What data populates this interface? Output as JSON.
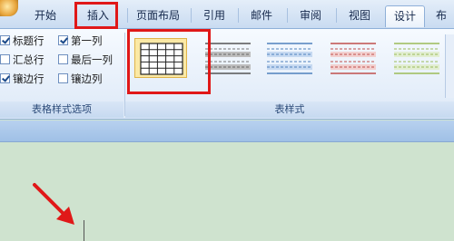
{
  "tabs": [
    {
      "label": "开始"
    },
    {
      "label": "插入"
    },
    {
      "label": "页面布局"
    },
    {
      "label": "引用"
    },
    {
      "label": "邮件"
    },
    {
      "label": "审阅"
    },
    {
      "label": "视图"
    },
    {
      "label": "设计"
    },
    {
      "label": "布"
    }
  ],
  "active_tab": "设计",
  "style_options": {
    "group_label": "表格样式选项",
    "items": [
      {
        "label": "标题行",
        "checked": true
      },
      {
        "label": "第一列",
        "checked": true
      },
      {
        "label": "汇总行",
        "checked": false
      },
      {
        "label": "最后一列",
        "checked": false
      },
      {
        "label": "镶边行",
        "checked": true
      },
      {
        "label": "镶边列",
        "checked": false
      }
    ]
  },
  "table_styles": {
    "group_label": "表样式",
    "thumbnails": [
      {
        "selected": true,
        "color": "#222222"
      },
      {
        "selected": false,
        "color": "#8a8a8a"
      },
      {
        "selected": false,
        "color": "#4f81bd"
      },
      {
        "selected": false,
        "color": "#c0504d"
      },
      {
        "selected": false,
        "color": "#9bbb59"
      }
    ]
  },
  "annotations": {
    "highlight_color": "#e01818"
  }
}
